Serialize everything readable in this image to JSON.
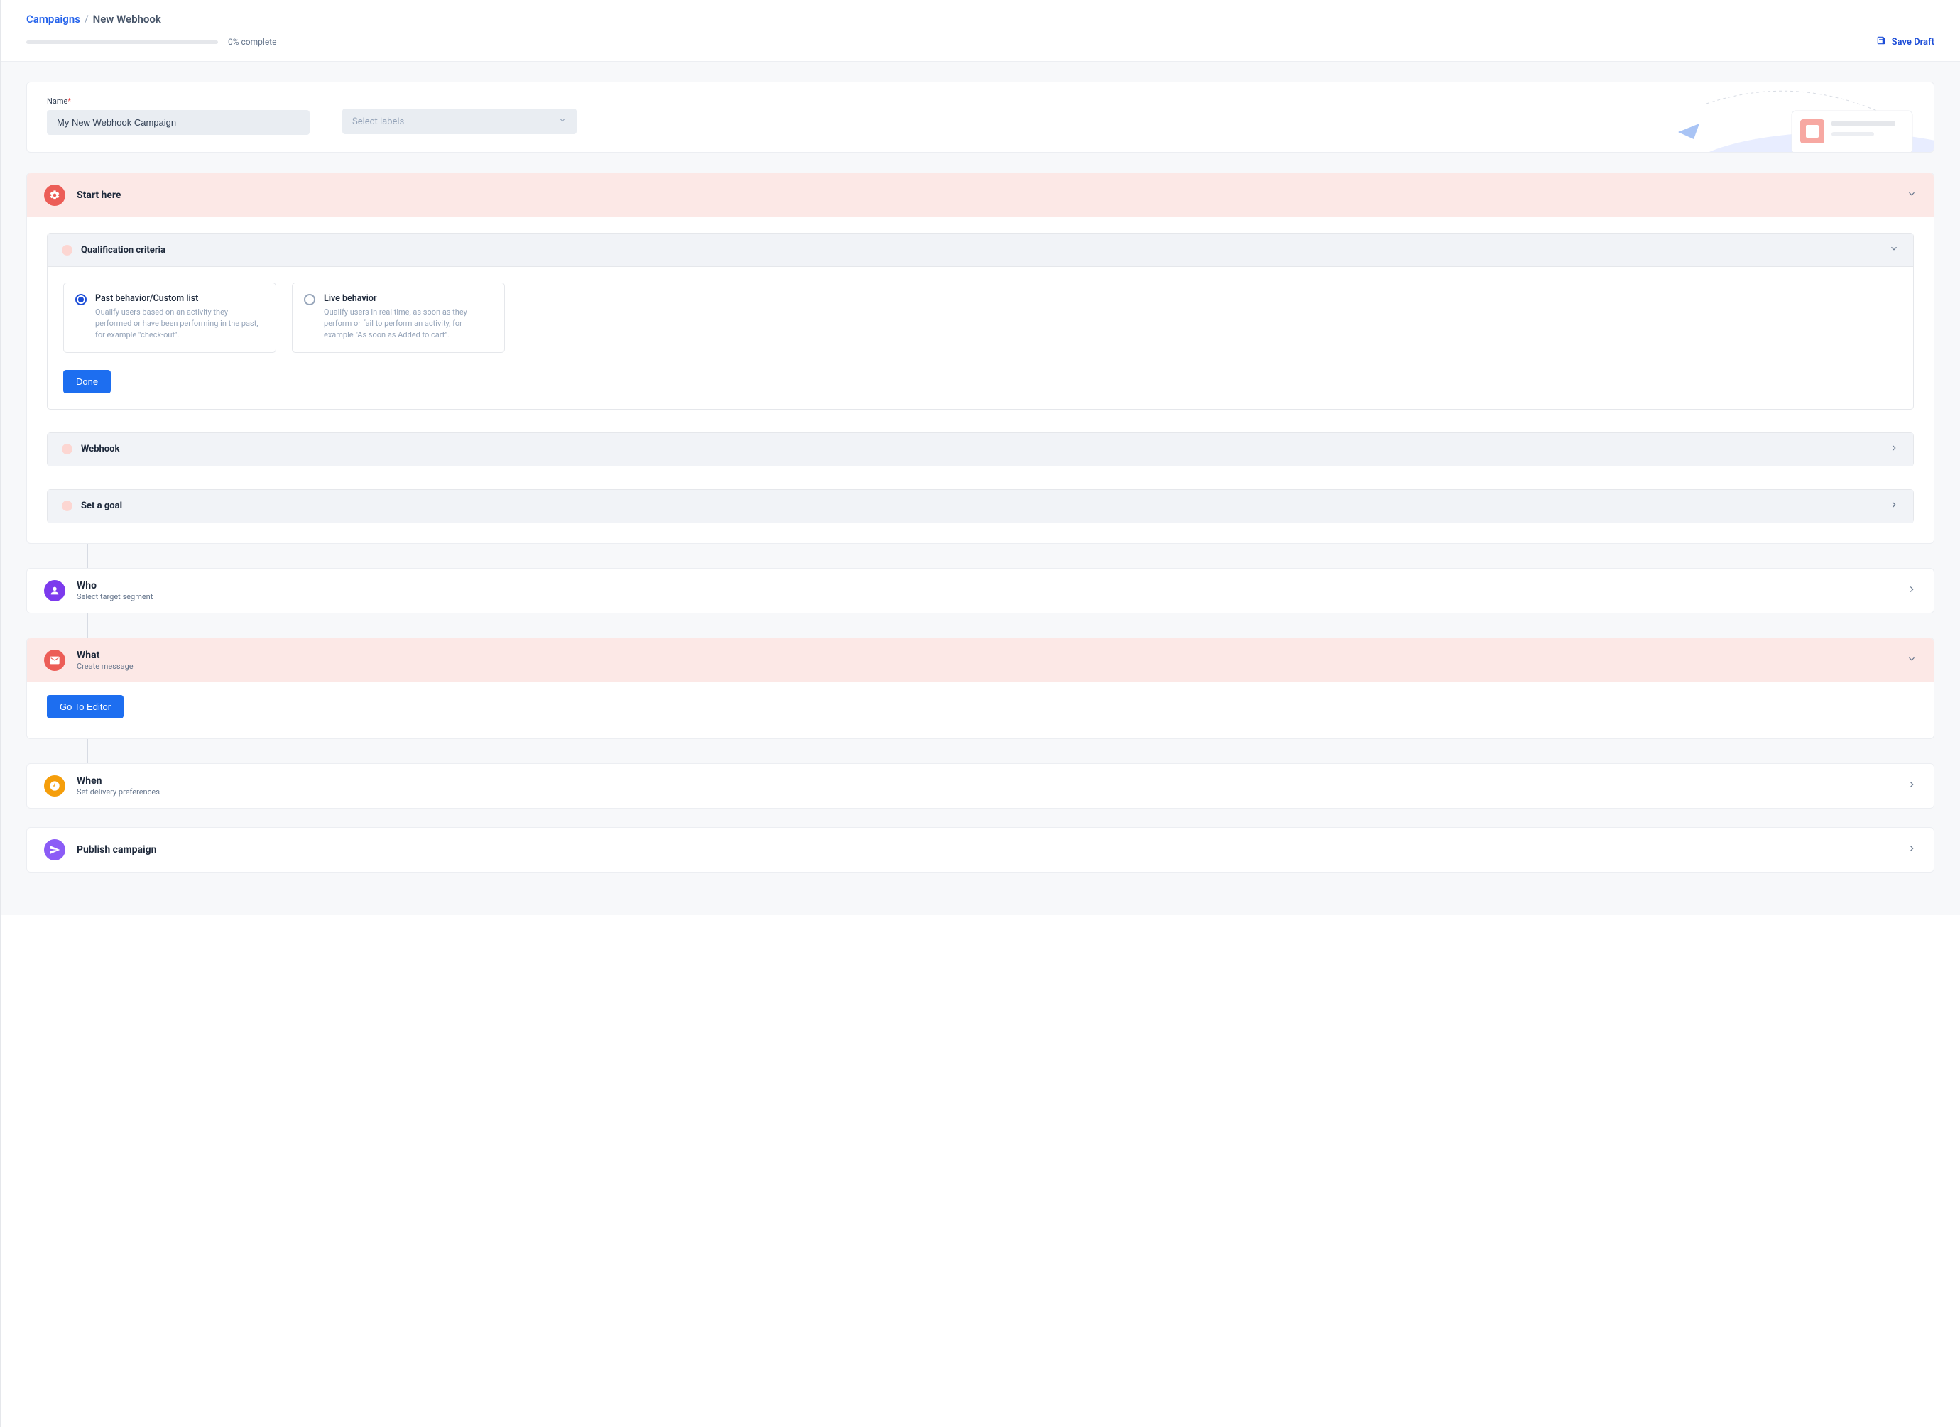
{
  "breadcrumb": {
    "root": "Campaigns",
    "current": "New Webhook"
  },
  "progress": {
    "text": "0% complete"
  },
  "actions": {
    "save_draft": "Save Draft"
  },
  "name_card": {
    "label": "Name",
    "value": "My New Webhook Campaign",
    "labels_placeholder": "Select labels"
  },
  "start": {
    "title": "Start here",
    "qualification": {
      "title": "Qualification criteria",
      "options": [
        {
          "title": "Past behavior/Custom list",
          "desc": "Qualify users based on an activity they performed or have been performing in the past, for example \"check-out\".",
          "selected": true
        },
        {
          "title": "Live behavior",
          "desc": "Qualify users in real time, as soon as they perform or fail to perform an activity, for example \"As soon as Added to cart\".",
          "selected": false
        }
      ],
      "done": "Done"
    },
    "webhook": {
      "title": "Webhook"
    },
    "goal": {
      "title": "Set a goal"
    }
  },
  "who": {
    "title": "Who",
    "sub": "Select target segment"
  },
  "what": {
    "title": "What",
    "sub": "Create message",
    "editor_btn": "Go To Editor"
  },
  "when": {
    "title": "When",
    "sub": "Set delivery preferences"
  },
  "publish": {
    "title": "Publish campaign"
  }
}
